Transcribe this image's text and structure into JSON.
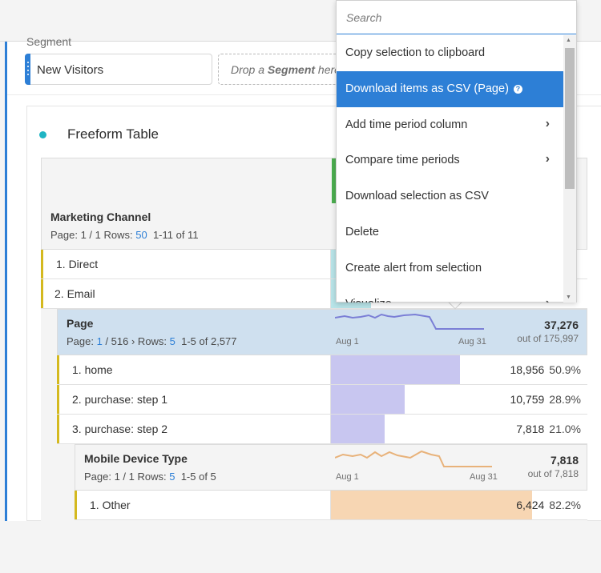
{
  "segment": {
    "label": "Segment",
    "chip": "New Visitors",
    "drop_prefix": "Drop a ",
    "drop_bold": "Segment",
    "drop_suffix": " here"
  },
  "freeform": {
    "title": "Freeform Table",
    "dimension": {
      "name": "Marketing Channel",
      "page_label": "Page: 1 / 1 Rows: ",
      "rows": "50",
      "range": "1-11 of 11",
      "items": [
        {
          "label": "1. Direct"
        },
        {
          "label": "2. Email"
        }
      ]
    },
    "page_breakdown": {
      "name": "Page",
      "page_prefix": "Page: ",
      "page": "1",
      "page_total": " / 516 ",
      "rows_label": " Rows: ",
      "rows": "5",
      "range": "1-5 of 2,577",
      "spark_start": "Aug 1",
      "spark_end": "Aug 31",
      "total": "37,276",
      "out_of": "out of 175,997",
      "color": "#c8c6f0",
      "line_color": "#7b7fd6",
      "items": [
        {
          "label": "1. home",
          "value": "18,956",
          "pct": "50.9%",
          "share": 0.509
        },
        {
          "label": "2. purchase: step 1",
          "value": "10,759",
          "pct": "28.9%",
          "share": 0.289
        },
        {
          "label": "3. purchase: step 2",
          "value": "7,818",
          "pct": "21.0%",
          "share": 0.21
        }
      ]
    },
    "device_breakdown": {
      "name": "Mobile Device Type",
      "page_label": "Page: 1 / 1 Rows: ",
      "rows": "5",
      "range": "1-5 of 5",
      "spark_start": "Aug 1",
      "spark_end": "Aug 31",
      "total": "7,818",
      "out_of": "out of 7,818",
      "color": "#f7d6b3",
      "line_color": "#e8b27a",
      "items": [
        {
          "label": "1. Other",
          "value": "6,424",
          "pct": "82.2%",
          "share": 0.822
        }
      ]
    }
  },
  "context_menu": {
    "search_placeholder": "Search",
    "items": [
      {
        "label": "Copy selection to clipboard",
        "submenu": false
      },
      {
        "label": "Download items as CSV (Page)",
        "submenu": false,
        "selected": true,
        "help": "?"
      },
      {
        "label": "Add time period column",
        "submenu": true
      },
      {
        "label": "Compare time periods",
        "submenu": true
      },
      {
        "label": "Download selection as CSV",
        "submenu": false
      },
      {
        "label": "Delete",
        "submenu": false
      },
      {
        "label": "Create alert from selection",
        "submenu": false
      },
      {
        "label": "Visualize",
        "submenu": true
      }
    ],
    "chevron": "›"
  },
  "colors": {
    "accent": "#2d7fd6",
    "teal_dot": "#1fb5c4",
    "row_accent": "#d4b91f",
    "green_handle": "#4caf50",
    "direct_fill": "#b8e4e8"
  }
}
